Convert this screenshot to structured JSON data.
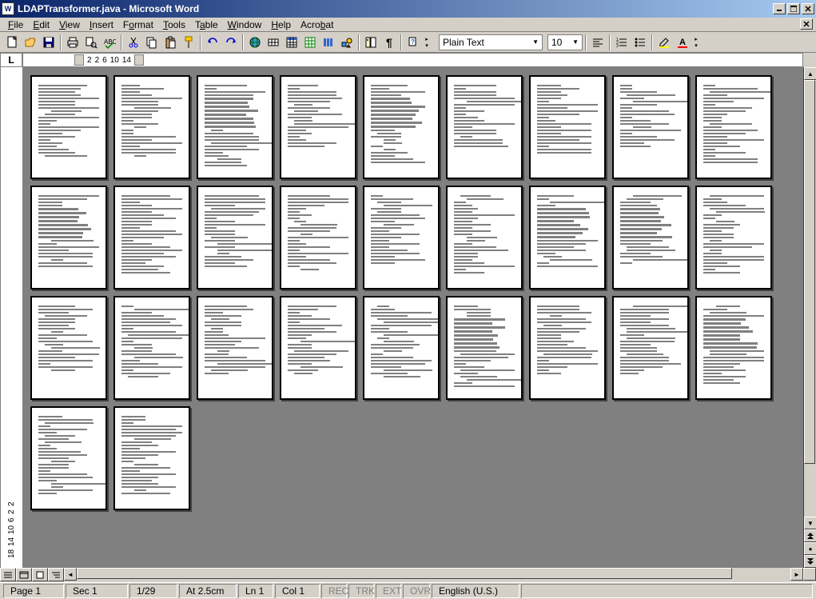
{
  "title": "LDAPTransformer.java - Microsoft Word",
  "app_icon_letter": "W",
  "menu": [
    {
      "label": "File",
      "key": "F"
    },
    {
      "label": "Edit",
      "key": "E"
    },
    {
      "label": "View",
      "key": "V"
    },
    {
      "label": "Insert",
      "key": "I"
    },
    {
      "label": "Format",
      "key": "o"
    },
    {
      "label": "Tools",
      "key": "T"
    },
    {
      "label": "Table",
      "key": "a"
    },
    {
      "label": "Window",
      "key": "W"
    },
    {
      "label": "Help",
      "key": "H"
    },
    {
      "label": "Acrobat",
      "key": "b"
    }
  ],
  "style_select": "Plain Text",
  "font_size": "10",
  "ruler_h": [
    "2",
    "2",
    "6",
    "10",
    "14"
  ],
  "ruler_v": [
    "2",
    "2",
    "6",
    "10",
    "14",
    "18"
  ],
  "ruler_corner": "L",
  "page_count": 29,
  "status": {
    "page": "Page 1",
    "sec": "Sec 1",
    "pages": "1/29",
    "at": "At 2.5cm",
    "ln": "Ln 1",
    "col": "Col 1",
    "rec": "REC",
    "trk": "TRK",
    "ext": "EXT",
    "ovr": "OVR",
    "lang": "English (U.S.)"
  },
  "window_controls": {
    "min": "_",
    "max": "□",
    "close": "×"
  }
}
